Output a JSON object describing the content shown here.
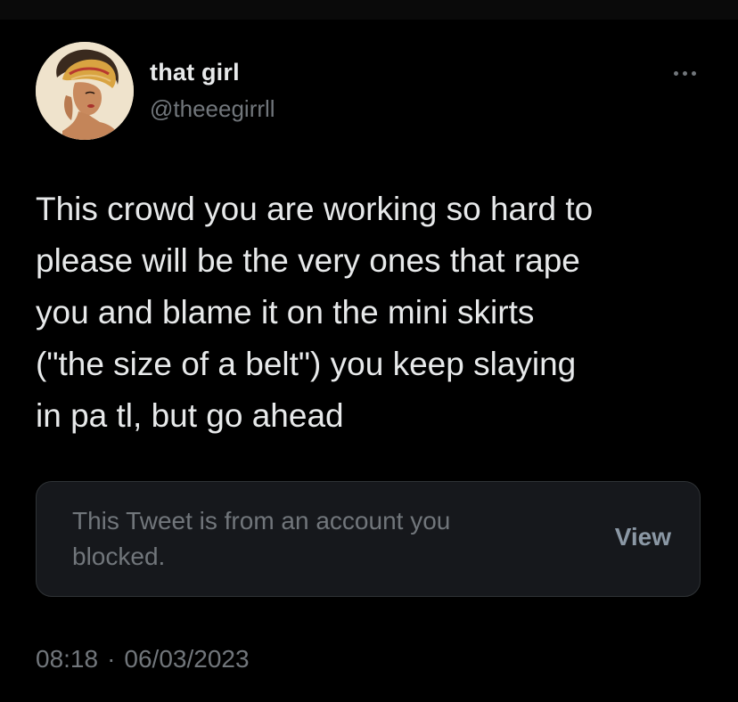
{
  "tweet": {
    "author": {
      "display_name": "that girl",
      "handle": "@theeegirrll",
      "avatar_icon": "avatar-illustration-icon"
    },
    "more_icon": "more-options-icon",
    "text_lines": [
      "This crowd you are working so hard to",
      "please will be the very ones that rape",
      "you and blame it on the mini skirts",
      "(\"the size of a belt\") you keep slaying",
      "in pa tl, but go ahead"
    ],
    "quoted": {
      "message_lines": [
        "This Tweet is from an account you",
        "blocked."
      ],
      "view_label": "View"
    },
    "time": "08:18",
    "separator": "·",
    "date": "06/03/2023"
  },
  "colors": {
    "background": "#000000",
    "primary_text": "#e7e9ea",
    "secondary_text": "#71767b",
    "card_background": "#16181c",
    "card_border": "#2f3336"
  }
}
